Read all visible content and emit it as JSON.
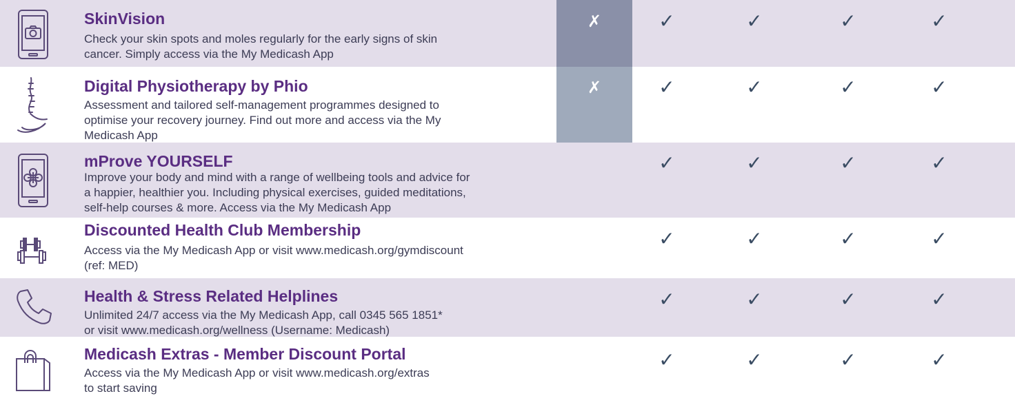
{
  "colors": {
    "shaded_row": "#e3ddea",
    "title": "#5a2d82",
    "description": "#3c3c55",
    "check": "#3a4c63",
    "unavailable_column_dark": "#8a90a8",
    "unavailable_column_light": "#9faabb"
  },
  "check_symbol": "✓",
  "cross_symbol": "✗",
  "rows": [
    {
      "icon": "tablet-camera-icon",
      "title": "SkinVision",
      "desc_lines": [
        "Check your skin spots and moles regularly for the early signs of skin",
        "cancer. Simply access via the My Medicash App"
      ],
      "tiers": [
        "✗",
        "✓",
        "✓",
        "✓",
        "✓"
      ]
    },
    {
      "icon": "spine-icon",
      "title": "Digital Physiotherapy by Phio",
      "desc_lines": [
        "Assessment and tailored self-management programmes designed to",
        "optimise your recovery journey. Find out more and access via the My",
        "Medicash App"
      ],
      "tiers": [
        "✗",
        "✓",
        "✓",
        "✓",
        "✓"
      ]
    },
    {
      "icon": "tablet-wellbeing-icon",
      "title": "mProve YOURSELF",
      "desc_lines": [
        "Improve your body and mind with a range of wellbeing tools and advice for",
        "a happier, healthier you. Including physical exercises, guided meditations,",
        "self-help courses & more. Access via the My Medicash App"
      ],
      "tiers": [
        "",
        "✓",
        "✓",
        "✓",
        "✓"
      ]
    },
    {
      "icon": "dumbbell-icon",
      "title": "Discounted Health Club Membership",
      "desc_lines": [
        "Access via the My Medicash App or visit www.medicash.org/gymdiscount",
        "(ref: MED)"
      ],
      "tiers": [
        "",
        "✓",
        "✓",
        "✓",
        "✓"
      ]
    },
    {
      "icon": "phone-icon",
      "title": "Health & Stress Related Helplines",
      "desc_lines": [
        "Unlimited 24/7 access via the My Medicash App, call 0345 565 1851*",
        "or visit www.medicash.org/wellness (Username: Medicash)"
      ],
      "tiers": [
        "",
        "✓",
        "✓",
        "✓",
        "✓"
      ]
    },
    {
      "icon": "shopping-bag-icon",
      "title": "Medicash Extras - Member Discount Portal",
      "desc_lines": [
        "Access via the My Medicash App or visit www.medicash.org/extras",
        "to start saving"
      ],
      "tiers": [
        "",
        "✓",
        "✓",
        "✓",
        "✓"
      ]
    }
  ]
}
